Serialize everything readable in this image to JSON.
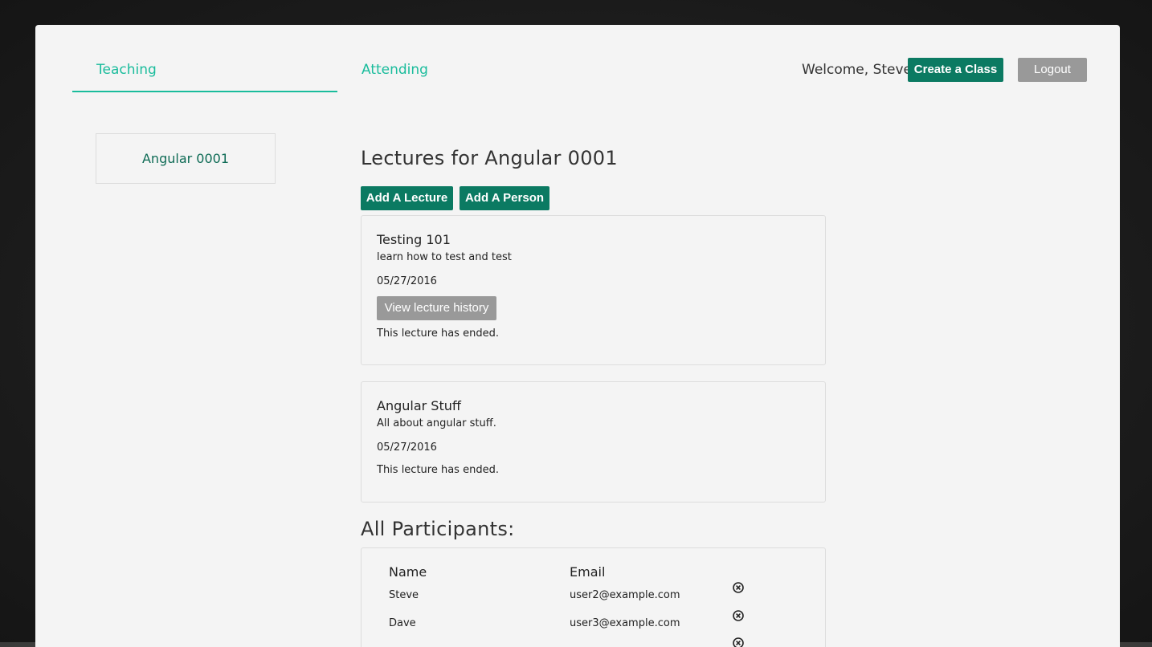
{
  "nav": {
    "tabs": [
      {
        "label": "Teaching",
        "active": true
      },
      {
        "label": "Attending",
        "active": false
      }
    ],
    "welcome_text": "Welcome, Steve",
    "create_class_label": "Create a Class",
    "logout_label": "Logout"
  },
  "sidebar": {
    "classes": [
      {
        "name": "Angular 0001"
      }
    ]
  },
  "main": {
    "lectures_title": "Lectures for Angular 0001",
    "add_lecture_label": "Add A Lecture",
    "add_person_label": "Add A Person",
    "lectures": [
      {
        "title": "Testing 101",
        "description": "learn how to test and test",
        "date": "05/27/2016",
        "history_button_label": "View lecture history",
        "status": "This lecture has ended."
      },
      {
        "title": "Angular Stuff",
        "description": "All about angular stuff.",
        "date": "05/27/2016",
        "status": "This lecture has ended."
      }
    ],
    "participants_title": "All Participants:",
    "participants_table": {
      "headers": [
        "Name",
        "Email"
      ],
      "rows": [
        {
          "name": "Steve",
          "email": "user2@example.com"
        },
        {
          "name": "Dave",
          "email": "user3@example.com"
        }
      ]
    }
  },
  "colors": {
    "accent": "#1abc9c",
    "primary_button": "#0b7a62",
    "secondary_button": "#999999",
    "panel_background": "#f4f4f4"
  },
  "icons": {
    "remove": "circle-x-icon"
  }
}
